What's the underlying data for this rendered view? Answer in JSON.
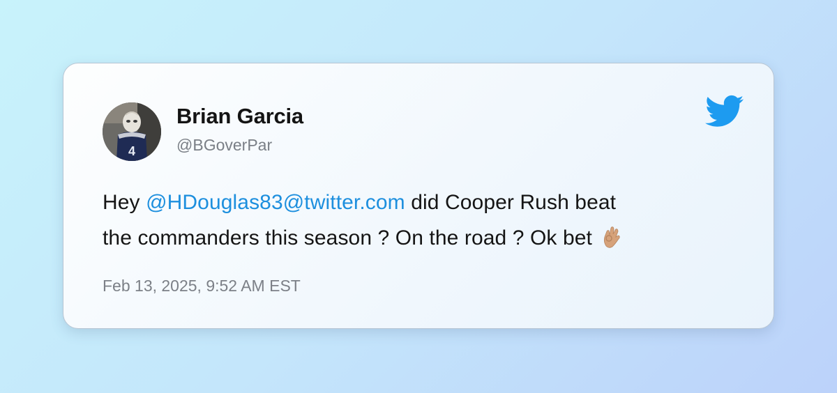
{
  "tweet": {
    "author_name": "Brian Garcia",
    "author_handle": "@BGoverPar",
    "text_prefix": "Hey ",
    "mention": "@HDouglas83@twitter.com",
    "text_line1_rest": " did Cooper Rush beat",
    "text_line2": "the commanders this season ? On the road ? Ok bet ",
    "emoji": "ok-hand-icon",
    "timestamp": "Feb 13, 2025, 9:52 AM EST"
  },
  "avatar": {
    "jersey_number": "4",
    "depicts": "masked figure in navy football jersey"
  },
  "brand": {
    "icon": "twitter-bird-icon",
    "color": "#1d9bf0"
  },
  "colors": {
    "mention": "#1d8fde",
    "text": "#151515",
    "muted": "#7a7f86"
  }
}
